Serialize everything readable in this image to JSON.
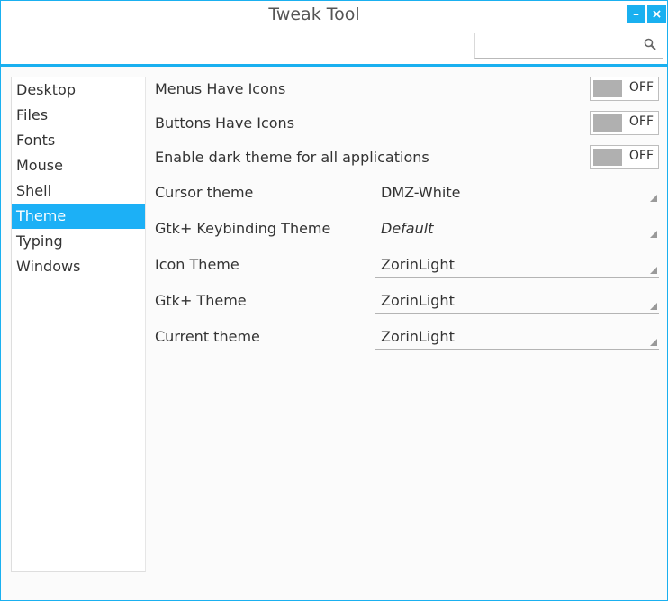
{
  "window": {
    "title": "Tweak Tool",
    "accent_color": "#1ab0f0",
    "minimize_label": "–",
    "close_label": "×"
  },
  "search": {
    "placeholder": "",
    "icon": "search-icon"
  },
  "sidebar": {
    "items": [
      {
        "label": "Desktop",
        "selected": false
      },
      {
        "label": "Files",
        "selected": false
      },
      {
        "label": "Fonts",
        "selected": false
      },
      {
        "label": "Mouse",
        "selected": false
      },
      {
        "label": "Shell",
        "selected": false
      },
      {
        "label": "Theme",
        "selected": true
      },
      {
        "label": "Typing",
        "selected": false
      },
      {
        "label": "Windows",
        "selected": false
      }
    ]
  },
  "settings": {
    "toggles": [
      {
        "label": "Menus Have Icons",
        "state": "OFF"
      },
      {
        "label": "Buttons Have Icons",
        "state": "OFF"
      },
      {
        "label": "Enable dark theme for all applications",
        "state": "OFF"
      }
    ],
    "combos": [
      {
        "label": "Cursor theme",
        "value": "DMZ-White",
        "italic": false
      },
      {
        "label": "Gtk+ Keybinding Theme",
        "value": "Default",
        "italic": true
      },
      {
        "label": "Icon Theme",
        "value": "ZorinLight",
        "italic": false
      },
      {
        "label": "Gtk+ Theme",
        "value": "ZorinLight",
        "italic": false
      },
      {
        "label": "Current theme",
        "value": "ZorinLight",
        "italic": false
      }
    ]
  }
}
